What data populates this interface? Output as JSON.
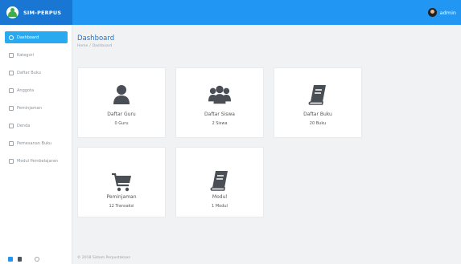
{
  "brand": {
    "name": "SIM-PERPUS",
    "logo_icon": "logo-icon"
  },
  "user": {
    "name": "admin",
    "avatar_icon": "user-avatar-icon"
  },
  "sidebar": {
    "items": [
      {
        "label": "Dashboard",
        "icon": "dashboard-icon",
        "active": true
      },
      {
        "label": "Kategori",
        "icon": "category-icon"
      },
      {
        "label": "Daftar Buku",
        "icon": "book-list-icon"
      },
      {
        "label": "Anggota",
        "icon": "members-icon"
      },
      {
        "label": "Peminjaman",
        "icon": "loan-icon"
      },
      {
        "label": "Denda",
        "icon": "fine-icon"
      },
      {
        "label": "Pemesanan Buku",
        "icon": "book-order-icon"
      },
      {
        "label": "Modul Pembelajaran",
        "icon": "module-icon"
      }
    ]
  },
  "header": {
    "title": "Dashboard",
    "breadcrumb": [
      "Home",
      "Dashboard"
    ]
  },
  "cards": [
    {
      "title": "Daftar Guru",
      "value": "0 Guru",
      "icon": "teacher-icon"
    },
    {
      "title": "Daftar Siswa",
      "value": "2 Siswa",
      "icon": "students-icon"
    },
    {
      "title": "Daftar Buku",
      "value": "20 Buku",
      "icon": "book-icon"
    },
    {
      "title": "Peminjaman",
      "value": "12 Transaksi",
      "icon": "cart-icon"
    },
    {
      "title": "Modul",
      "value": "1 Modul",
      "icon": "module-book-icon"
    }
  ],
  "footer": {
    "copyright": "© 2018 Sistem Perpustakaan"
  },
  "colors": {
    "topbar": "#2196f3",
    "brand": "#1976d2",
    "active": "#29a9f0"
  }
}
